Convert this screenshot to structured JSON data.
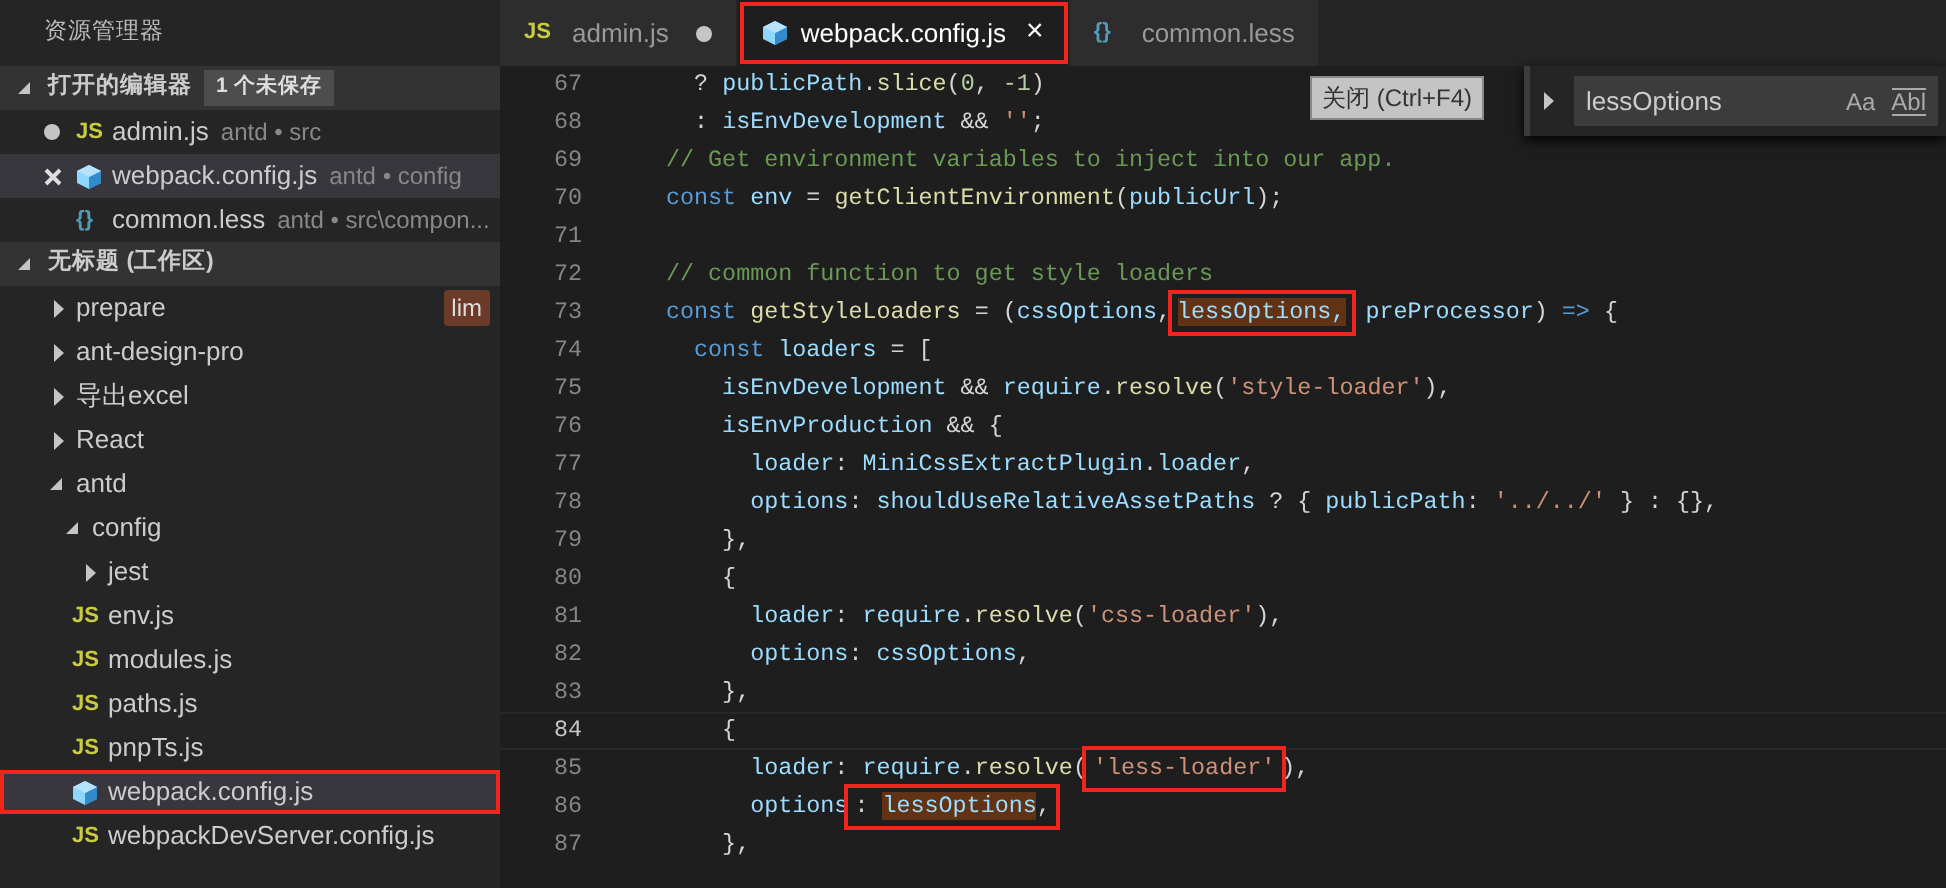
{
  "sidebar": {
    "title": "资源管理器",
    "open_editors": {
      "title": "打开的编辑器",
      "badge": "1 个未保存",
      "expanded": true,
      "items": [
        {
          "label": "admin.js",
          "kind": "js",
          "icon": "JS",
          "description": "antd • src",
          "dirty": true,
          "selected": false
        },
        {
          "label": "webpack.config.js",
          "kind": "webpack",
          "description": "antd • config",
          "dirty": false,
          "selected": true
        },
        {
          "label": "common.less",
          "kind": "less",
          "icon": "{}",
          "description": "antd • src\\compon...",
          "dirty": false,
          "selected": false
        }
      ]
    },
    "workspace": {
      "title": "无标题 (工作区)",
      "expanded": true,
      "items": [
        {
          "label": "prepare",
          "kind": "folder",
          "expanded": false,
          "selected": false,
          "tag": "lim"
        },
        {
          "label": "ant-design-pro",
          "kind": "folder",
          "expanded": false,
          "selected": false
        },
        {
          "label": "导出excel",
          "kind": "folder",
          "expanded": false,
          "selected": false
        },
        {
          "label": "React",
          "kind": "folder",
          "expanded": false,
          "selected": false
        },
        {
          "label": "antd",
          "kind": "folder",
          "expanded": true,
          "selected": false,
          "children": [
            {
              "label": "config",
              "kind": "folder",
              "expanded": true,
              "selected": false,
              "children": [
                {
                  "label": "jest",
                  "kind": "folder",
                  "expanded": false,
                  "selected": false
                },
                {
                  "label": "env.js",
                  "kind": "js",
                  "icon": "JS",
                  "selected": false
                },
                {
                  "label": "modules.js",
                  "kind": "js",
                  "icon": "JS",
                  "selected": false
                },
                {
                  "label": "paths.js",
                  "kind": "js",
                  "icon": "JS",
                  "selected": false
                },
                {
                  "label": "pnpTs.js",
                  "kind": "js",
                  "icon": "JS",
                  "selected": false
                },
                {
                  "label": "webpack.config.js",
                  "kind": "webpack",
                  "selected": true,
                  "framed": true
                },
                {
                  "label": "webpackDevServer.config.js",
                  "kind": "js",
                  "icon": "JS",
                  "selected": false
                }
              ]
            }
          ]
        }
      ]
    }
  },
  "tabs": [
    {
      "label": "admin.js",
      "kind": "js",
      "icon": "JS",
      "selected": false,
      "dirty": true
    },
    {
      "label": "webpack.config.js",
      "kind": "webpack",
      "selected": true,
      "dirty": false,
      "close": "×",
      "framed": true
    },
    {
      "label": "common.less",
      "kind": "less",
      "icon": "{}",
      "selected": false,
      "dirty": false
    }
  ],
  "tooltip": "关闭 (Ctrl+F4)",
  "find": {
    "value": "lessOptions",
    "expanded": false,
    "options": [
      "Aa",
      "Abl"
    ]
  },
  "code": [
    {
      "number": "67",
      "tokens": [
        {
          "text": "  ? ",
          "kind": "pun"
        },
        {
          "text": "publicPath",
          "kind": "var"
        },
        {
          "text": ".",
          "kind": "pun"
        },
        {
          "text": "slice",
          "kind": "fn"
        },
        {
          "text": "(",
          "kind": "pun"
        },
        {
          "text": "0",
          "kind": "num"
        },
        {
          "text": ", ",
          "kind": "pun"
        },
        {
          "text": "-1",
          "kind": "num"
        },
        {
          "text": ")",
          "kind": "pun"
        }
      ]
    },
    {
      "number": "68",
      "tokens": [
        {
          "text": "  : ",
          "kind": "pun"
        },
        {
          "text": "isEnvDevelopment",
          "kind": "var"
        },
        {
          "text": " && ",
          "kind": "pun"
        },
        {
          "text": "''",
          "kind": "str"
        },
        {
          "text": ";",
          "kind": "pun"
        }
      ]
    },
    {
      "number": "69",
      "tokens": [
        {
          "text": "// Get environment variables to inject into our app.",
          "kind": "cmt"
        }
      ]
    },
    {
      "number": "70",
      "tokens": [
        {
          "text": "const ",
          "kind": "kw"
        },
        {
          "text": "env",
          "kind": "var"
        },
        {
          "text": " = ",
          "kind": "pun"
        },
        {
          "text": "getClientEnvironment",
          "kind": "fn"
        },
        {
          "text": "(",
          "kind": "pun"
        },
        {
          "text": "publicUrl",
          "kind": "var"
        },
        {
          "text": ");",
          "kind": "pun"
        }
      ]
    },
    {
      "number": "71"
    },
    {
      "number": "72",
      "tokens": [
        {
          "text": "// common function to get style loaders",
          "kind": "cmt"
        }
      ]
    },
    {
      "number": "73",
      "tokens": [
        {
          "text": "const ",
          "kind": "kw"
        },
        {
          "text": "getStyleLoaders",
          "kind": "fn"
        },
        {
          "text": " = (",
          "kind": "pun"
        },
        {
          "text": "cssOptions",
          "kind": "var"
        },
        {
          "text": ",",
          "kind": "pun"
        },
        {
          "text": "lessOptions,",
          "kind": "var",
          "match": true,
          "framed": true
        },
        {
          "text": " preProcessor",
          "kind": "var"
        },
        {
          "text": ") ",
          "kind": "pun"
        },
        {
          "text": "=>",
          "kind": "kw"
        },
        {
          "text": " {",
          "kind": "pun"
        }
      ]
    },
    {
      "number": "74",
      "tokens": [
        {
          "text": "  const ",
          "kind": "kw"
        },
        {
          "text": "loaders",
          "kind": "var"
        },
        {
          "text": " = [",
          "kind": "pun"
        }
      ]
    },
    {
      "number": "75",
      "tokens": [
        {
          "text": "    isEnvDevelopment",
          "kind": "var"
        },
        {
          "text": " && ",
          "kind": "pun"
        },
        {
          "text": "require",
          "kind": "var"
        },
        {
          "text": ".",
          "kind": "pun"
        },
        {
          "text": "resolve",
          "kind": "fn"
        },
        {
          "text": "(",
          "kind": "pun"
        },
        {
          "text": "'style-loader'",
          "kind": "str"
        },
        {
          "text": "),",
          "kind": "pun"
        }
      ]
    },
    {
      "number": "76",
      "tokens": [
        {
          "text": "    isEnvProduction",
          "kind": "var"
        },
        {
          "text": " && {",
          "kind": "pun"
        }
      ]
    },
    {
      "number": "77",
      "tokens": [
        {
          "text": "      loader",
          "kind": "var"
        },
        {
          "text": ": ",
          "kind": "pun"
        },
        {
          "text": "MiniCssExtractPlugin",
          "kind": "var"
        },
        {
          "text": ".",
          "kind": "pun"
        },
        {
          "text": "loader",
          "kind": "var"
        },
        {
          "text": ",",
          "kind": "pun"
        }
      ]
    },
    {
      "number": "78",
      "tokens": [
        {
          "text": "      options",
          "kind": "var"
        },
        {
          "text": ": ",
          "kind": "pun"
        },
        {
          "text": "shouldUseRelativeAssetPaths",
          "kind": "var"
        },
        {
          "text": " ? { ",
          "kind": "pun"
        },
        {
          "text": "publicPath",
          "kind": "var"
        },
        {
          "text": ": ",
          "kind": "pun"
        },
        {
          "text": "'../../'",
          "kind": "str"
        },
        {
          "text": " } : {},",
          "kind": "pun"
        }
      ]
    },
    {
      "number": "79",
      "tokens": [
        {
          "text": "    },",
          "kind": "pun"
        }
      ]
    },
    {
      "number": "80",
      "tokens": [
        {
          "text": "    {",
          "kind": "pun"
        }
      ]
    },
    {
      "number": "81",
      "tokens": [
        {
          "text": "      loader",
          "kind": "var"
        },
        {
          "text": ": ",
          "kind": "pun"
        },
        {
          "text": "require",
          "kind": "var"
        },
        {
          "text": ".",
          "kind": "pun"
        },
        {
          "text": "resolve",
          "kind": "fn"
        },
        {
          "text": "(",
          "kind": "pun"
        },
        {
          "text": "'css-loader'",
          "kind": "str"
        },
        {
          "text": "),",
          "kind": "pun"
        }
      ]
    },
    {
      "number": "82",
      "tokens": [
        {
          "text": "      options",
          "kind": "var"
        },
        {
          "text": ": ",
          "kind": "pun"
        },
        {
          "text": "cssOptions",
          "kind": "var"
        },
        {
          "text": ",",
          "kind": "pun"
        }
      ]
    },
    {
      "number": "83",
      "tokens": [
        {
          "text": "    },",
          "kind": "pun"
        }
      ]
    },
    {
      "number": "84",
      "current": true,
      "tokens": [
        {
          "text": "    {",
          "kind": "pun"
        }
      ]
    },
    {
      "number": "85",
      "tokens": [
        {
          "text": "      loader",
          "kind": "var"
        },
        {
          "text": ": ",
          "kind": "pun"
        },
        {
          "text": "require",
          "kind": "var"
        },
        {
          "text": ".",
          "kind": "pun"
        },
        {
          "text": "resolve",
          "kind": "fn"
        },
        {
          "text": "(",
          "kind": "pun"
        },
        {
          "text": "'less-loader'",
          "kind": "str",
          "framed": true
        },
        {
          "text": "),",
          "kind": "pun"
        }
      ]
    },
    {
      "number": "86",
      "tokens": [
        {
          "text": "      options",
          "kind": "var"
        },
        {
          "text": ": ",
          "kind": "pun",
          "framed": true
        },
        {
          "text": "lessOptions",
          "kind": "var",
          "match": true,
          "framed": true
        },
        {
          "text": ",",
          "kind": "pun",
          "framed": true
        }
      ]
    },
    {
      "number": "87",
      "tokens": [
        {
          "text": "    },",
          "kind": "pun"
        }
      ]
    }
  ]
}
